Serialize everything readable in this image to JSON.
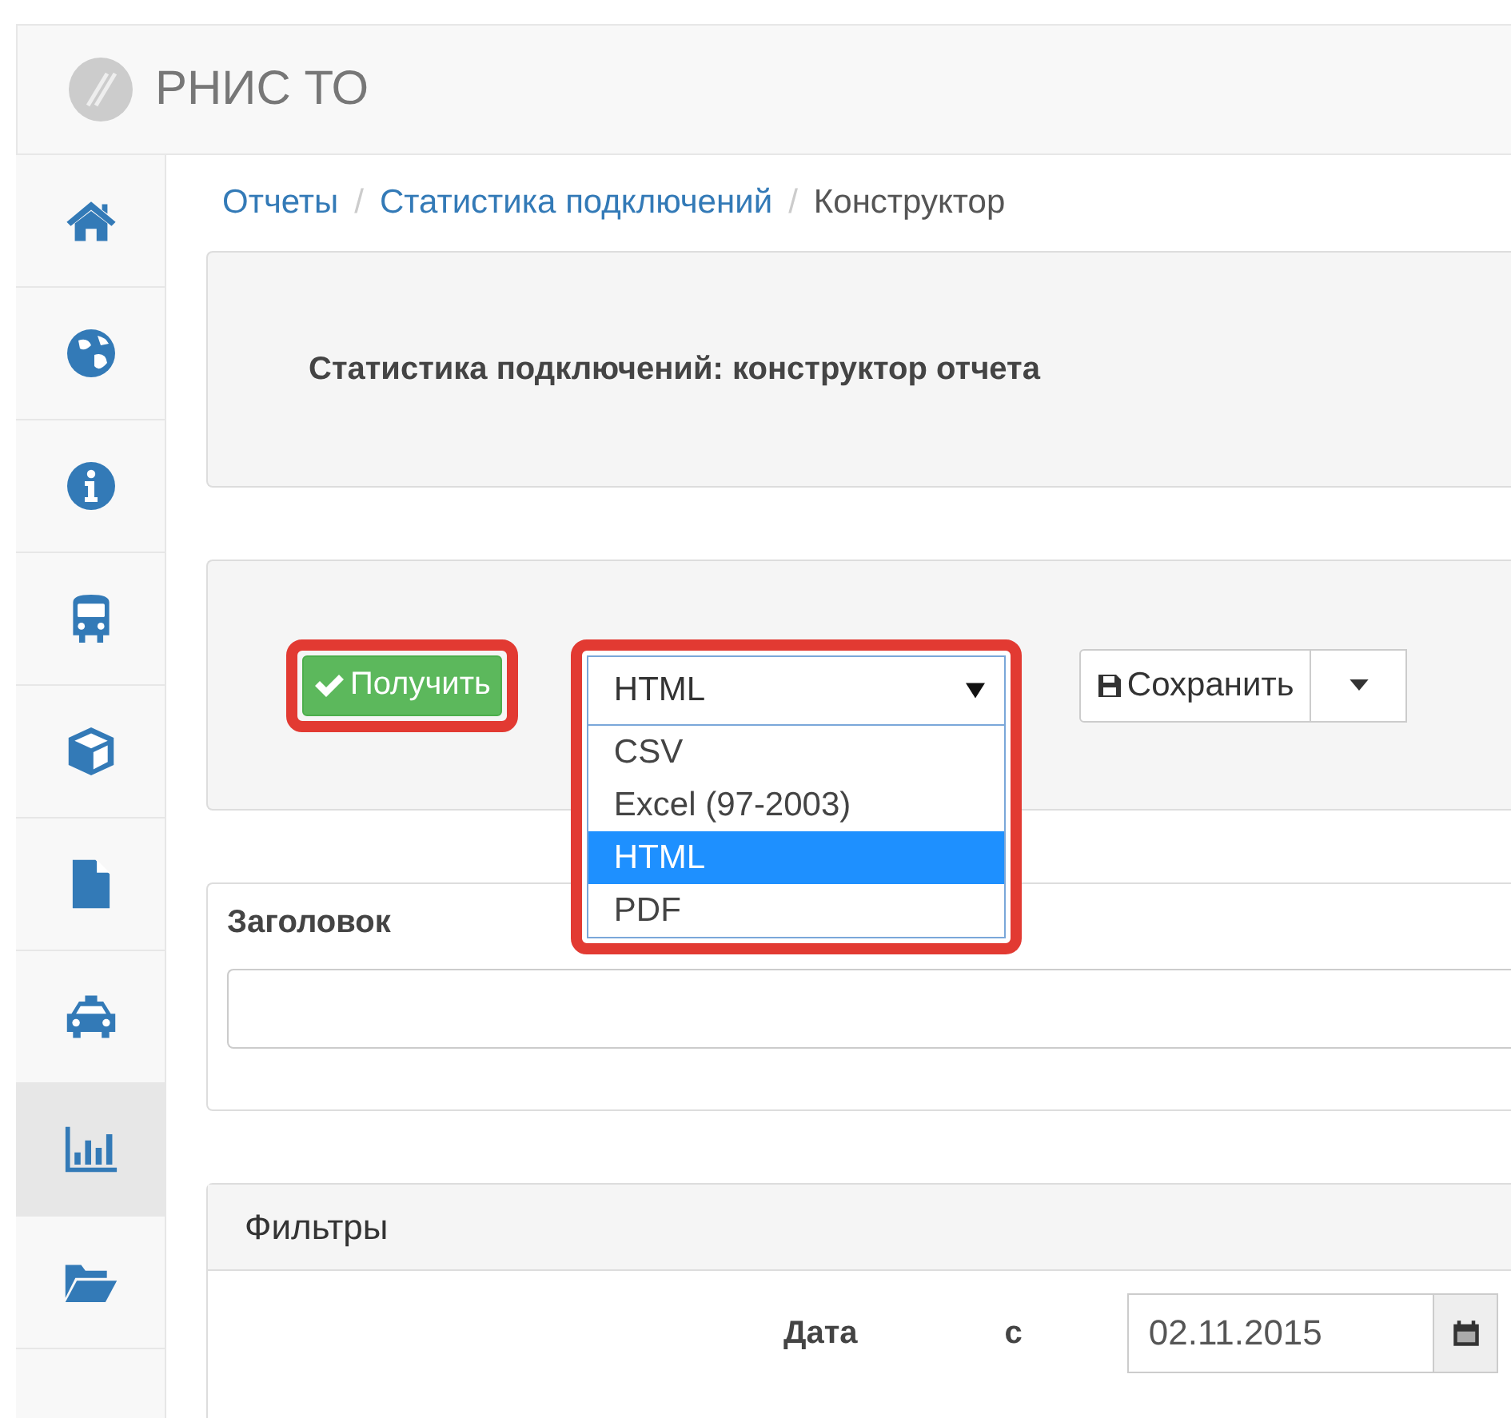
{
  "app": {
    "title": "РНИС ТО"
  },
  "sidebar": {
    "items": [
      {
        "kind": "home",
        "selected": false
      },
      {
        "kind": "globe",
        "selected": false
      },
      {
        "kind": "info",
        "selected": false
      },
      {
        "kind": "bus",
        "selected": false
      },
      {
        "kind": "cube",
        "selected": false
      },
      {
        "kind": "file",
        "selected": false
      },
      {
        "kind": "taxi",
        "selected": false
      },
      {
        "kind": "chart",
        "selected": true
      },
      {
        "kind": "folder",
        "selected": false
      }
    ]
  },
  "breadcrumb": {
    "items": [
      "Отчеты",
      "Статистика подключений",
      "Конструктор"
    ],
    "separators": [
      "/",
      "/"
    ]
  },
  "report_panel": {
    "title": "Статистика подключений: конструктор отчета"
  },
  "toolbar": {
    "get_button": {
      "label": "Получить",
      "highlighted": true
    },
    "format_select": {
      "value": "HTML",
      "expanded": true,
      "highlighted": true,
      "options": [
        {
          "label": "CSV",
          "selected": false
        },
        {
          "label": "Excel (97-2003)",
          "selected": false
        },
        {
          "label": "HTML",
          "selected": true
        },
        {
          "label": "PDF",
          "selected": false
        }
      ]
    },
    "save_button": {
      "label": "Сохранить"
    }
  },
  "title_field": {
    "label": "Заголовок"
  },
  "filters": {
    "title": "Фильтры",
    "rows": [
      {
        "label": "Дата",
        "from_label": "с",
        "value": "02.11.2015"
      }
    ]
  }
}
